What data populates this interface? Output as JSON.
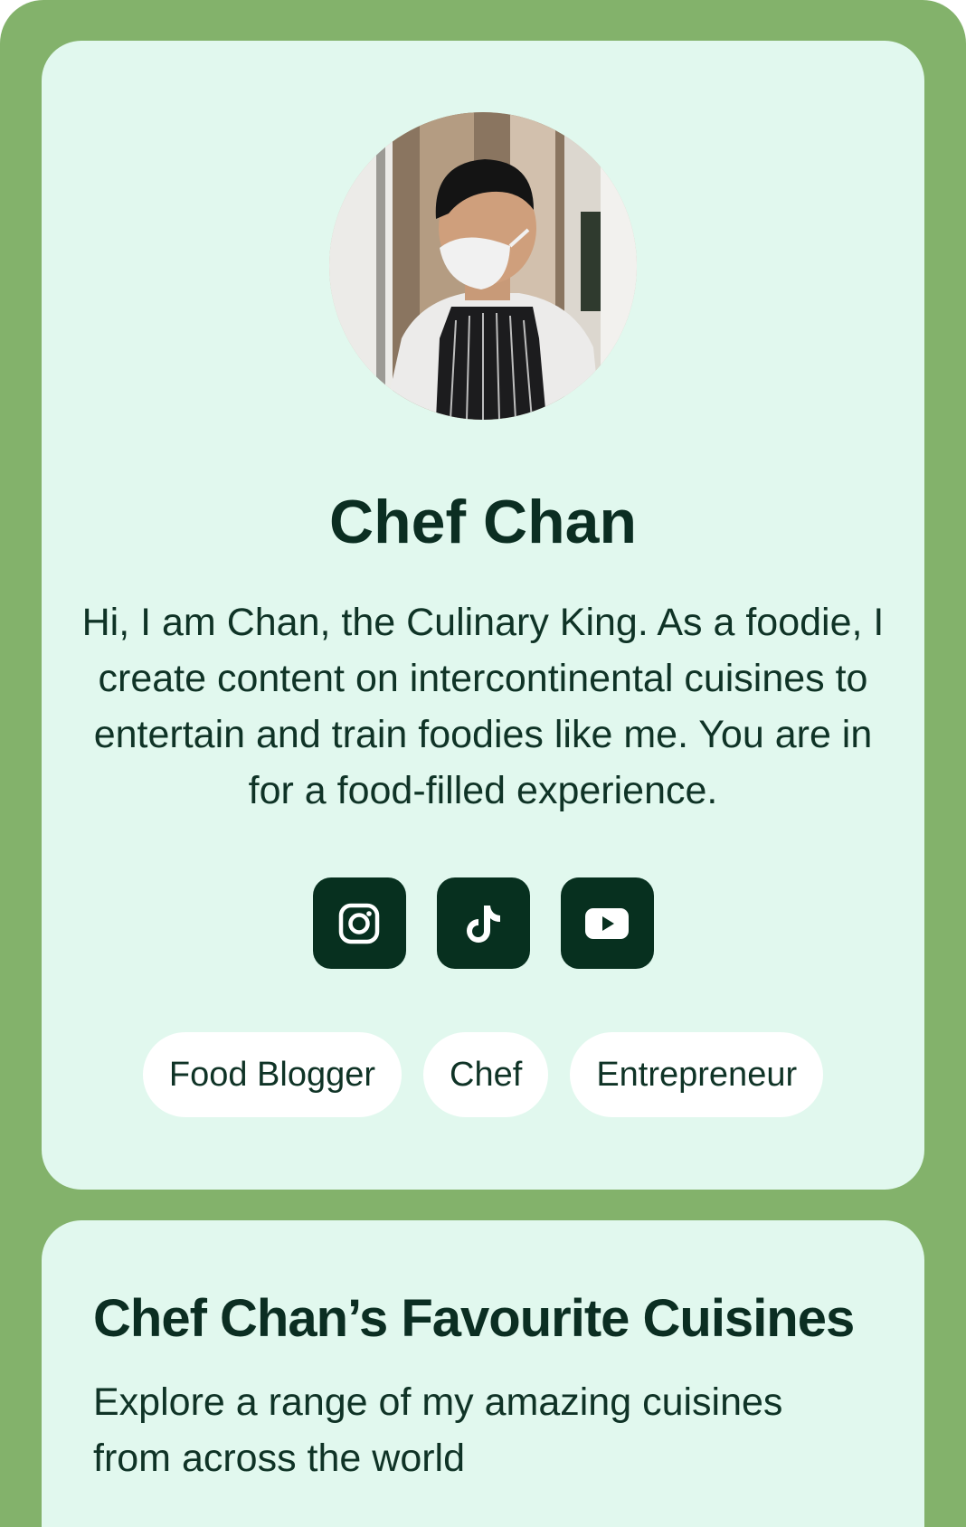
{
  "profile": {
    "avatar_alt": "Chef wearing a face mask and striped apron",
    "name": "Chef Chan",
    "bio": "Hi, I am Chan, the Culinary King. As a foodie, I create content on intercontinental cuisines to entertain and train foodies like me. You are in for a food-filled experience.",
    "socials": [
      {
        "icon": "instagram-icon"
      },
      {
        "icon": "tiktok-icon"
      },
      {
        "icon": "youtube-icon"
      }
    ],
    "tags": [
      "Food Blogger",
      "Chef",
      "Entrepreneur"
    ]
  },
  "cuisines": {
    "title": "Chef Chan’s Favourite Cuisines",
    "subtitle": "Explore a range of my amazing cuisines from across the world"
  },
  "colors": {
    "frame": "#83b26b",
    "card": "#e1f8ee",
    "dark": "#07301f",
    "tag_bg": "#ffffff"
  }
}
